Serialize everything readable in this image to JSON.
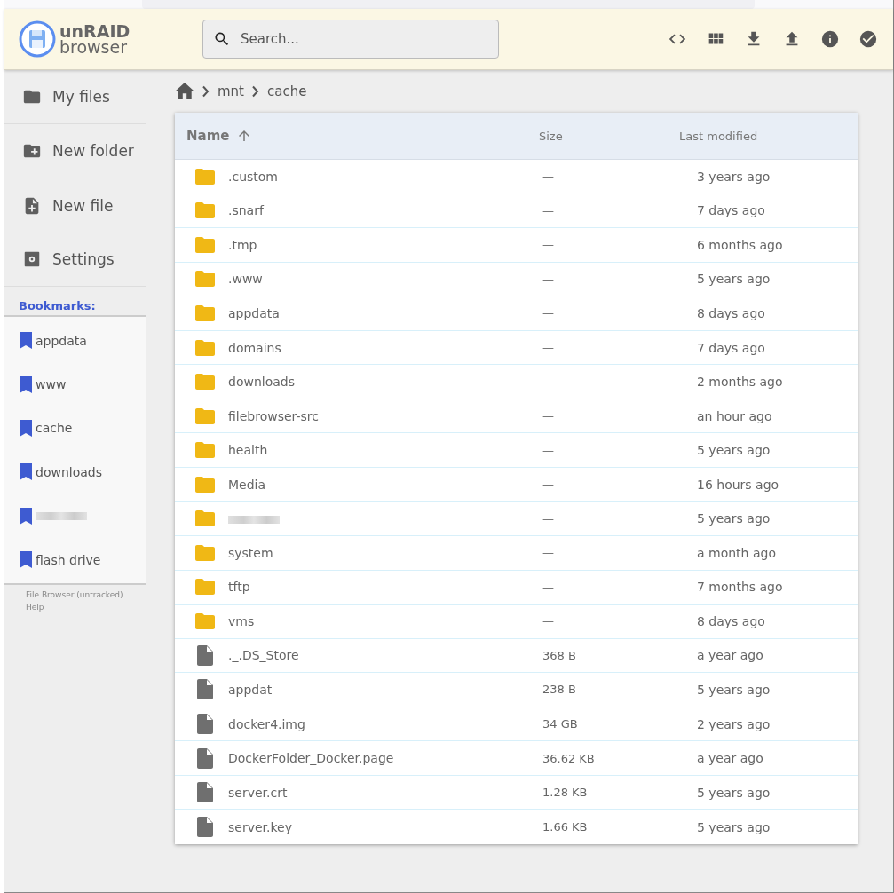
{
  "header": {
    "logo": {
      "line1": "unRAID",
      "line2": "browser"
    },
    "search": {
      "placeholder": "Search..."
    },
    "actions": [
      {
        "kind": "code"
      },
      {
        "kind": "grid"
      },
      {
        "kind": "download"
      },
      {
        "kind": "upload"
      },
      {
        "kind": "info"
      },
      {
        "kind": "check"
      }
    ]
  },
  "sidebar": {
    "items": [
      {
        "kind": "folder",
        "label": "My files"
      },
      {
        "kind": "new-folder",
        "label": "New folder"
      },
      {
        "kind": "new-file",
        "label": "New file"
      },
      {
        "kind": "settings",
        "label": "Settings"
      }
    ],
    "bookmarks_title": "Bookmarks:",
    "bookmarks": [
      {
        "label": "appdata"
      },
      {
        "label": "www"
      },
      {
        "label": "cache"
      },
      {
        "label": "downloads"
      },
      {
        "redacted": true
      },
      {
        "label": "flash drive"
      }
    ],
    "footer": [
      "File Browser (untracked)",
      "Help"
    ]
  },
  "breadcrumbs": [
    "mnt",
    "cache"
  ],
  "table": {
    "columns": [
      {
        "label": "Name",
        "sorted": true
      },
      {
        "label": "Size",
        "sorted": false
      },
      {
        "label": "Last modified",
        "sorted": false
      }
    ],
    "rows": [
      {
        "kind": "folder",
        "name": ".custom",
        "size": "—",
        "modified": "3 years ago"
      },
      {
        "kind": "folder",
        "name": ".snarf",
        "size": "—",
        "modified": "7 days ago"
      },
      {
        "kind": "folder",
        "name": ".tmp",
        "size": "—",
        "modified": "6 months ago"
      },
      {
        "kind": "folder",
        "name": ".www",
        "size": "—",
        "modified": "5 years ago"
      },
      {
        "kind": "folder",
        "name": "appdata",
        "size": "—",
        "modified": "8 days ago"
      },
      {
        "kind": "folder",
        "name": "domains",
        "size": "—",
        "modified": "7 days ago"
      },
      {
        "kind": "folder",
        "name": "downloads",
        "size": "—",
        "modified": "2 months ago"
      },
      {
        "kind": "folder",
        "name": "filebrowser-src",
        "size": "—",
        "modified": "an hour ago"
      },
      {
        "kind": "folder",
        "name": "health",
        "size": "—",
        "modified": "5 years ago"
      },
      {
        "kind": "folder",
        "name": "Media",
        "size": "—",
        "modified": "16 hours ago"
      },
      {
        "kind": "folder",
        "redacted": true,
        "size": "—",
        "modified": "5 years ago"
      },
      {
        "kind": "folder",
        "name": "system",
        "size": "—",
        "modified": "a month ago"
      },
      {
        "kind": "folder",
        "name": "tftp",
        "size": "—",
        "modified": "7 months ago"
      },
      {
        "kind": "folder",
        "name": "vms",
        "size": "—",
        "modified": "8 days ago"
      },
      {
        "kind": "file",
        "name": "._.DS_Store",
        "size": "368 B",
        "modified": "a year ago"
      },
      {
        "kind": "file",
        "name": "appdat",
        "size": "238 B",
        "modified": "5 years ago"
      },
      {
        "kind": "file",
        "name": "docker4.img",
        "size": "34 GB",
        "modified": "2 years ago"
      },
      {
        "kind": "file",
        "name": "DockerFolder_Docker.page",
        "size": "36.62 KB",
        "modified": "a year ago"
      },
      {
        "kind": "file",
        "name": "server.crt",
        "size": "1.28 KB",
        "modified": "5 years ago"
      },
      {
        "kind": "file",
        "name": "server.key",
        "size": "1.66 KB",
        "modified": "5 years ago"
      }
    ]
  }
}
